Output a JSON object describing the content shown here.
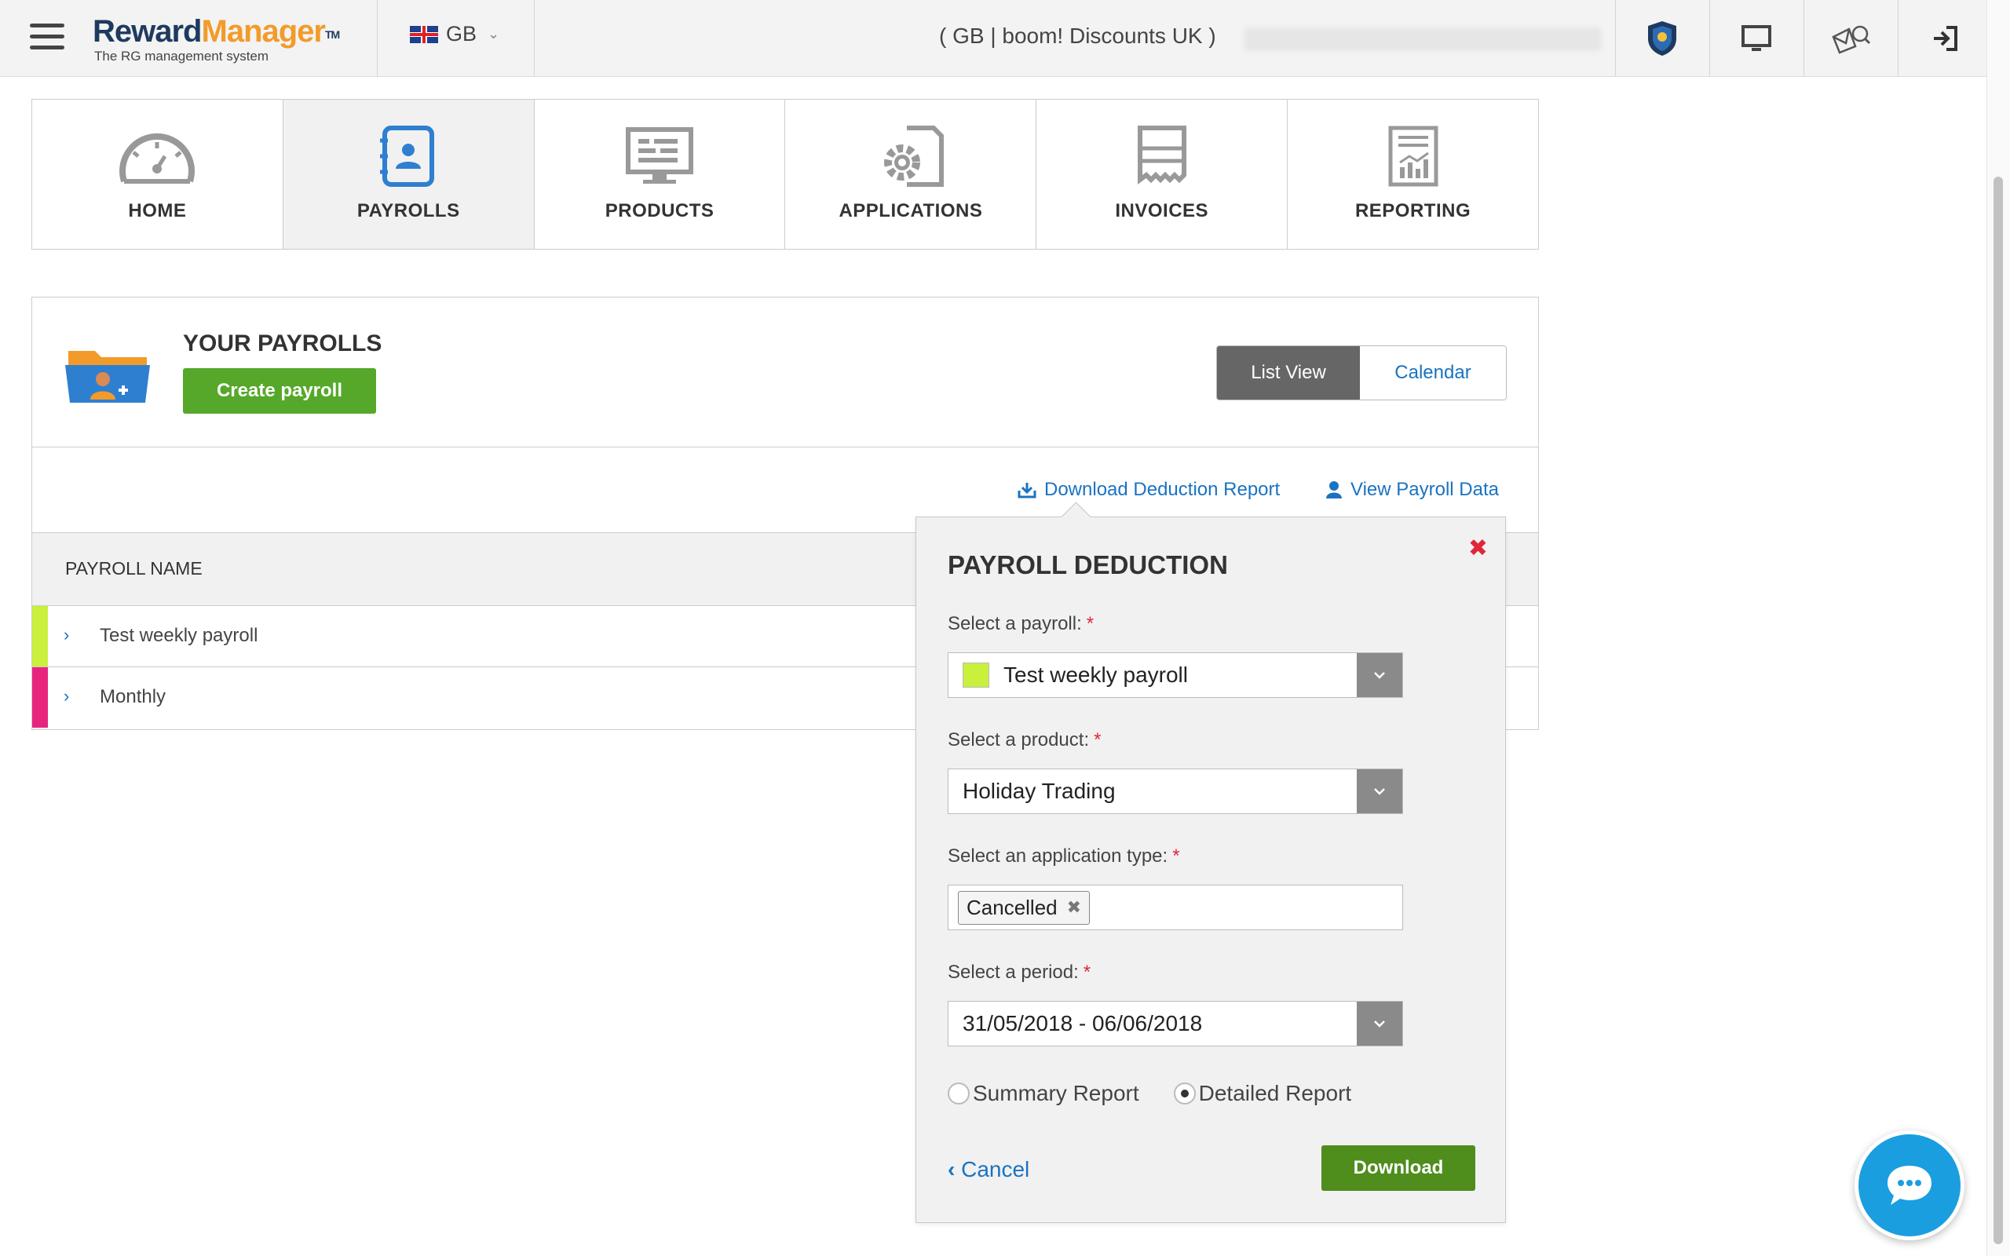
{
  "header": {
    "logo_reward": "Reward",
    "logo_manager": "Manager",
    "logo_tm": "TM",
    "logo_tagline": "The RG management system",
    "country_code": "GB",
    "company": "( GB | boom! Discounts UK )"
  },
  "nav": {
    "tiles": [
      {
        "label": "HOME",
        "icon": "dashboard-gauge-icon"
      },
      {
        "label": "PAYROLLS",
        "icon": "payroll-contact-book-icon",
        "active": true
      },
      {
        "label": "PRODUCTS",
        "icon": "monitor-products-icon"
      },
      {
        "label": "APPLICATIONS",
        "icon": "document-gear-icon"
      },
      {
        "label": "INVOICES",
        "icon": "receipt-icon"
      },
      {
        "label": "REPORTING",
        "icon": "report-chart-icon"
      }
    ]
  },
  "payrolls": {
    "title": "YOUR PAYROLLS",
    "create_label": "Create payroll",
    "view_list": "List View",
    "view_calendar": "Calendar",
    "download_link": "Download Deduction Report",
    "view_data_link": "View Payroll Data",
    "column_header": "PAYROLL NAME",
    "rows": [
      {
        "name": "Test weekly payroll",
        "color": "#c8f03c"
      },
      {
        "name": "Monthly",
        "color": "#e8257e"
      }
    ]
  },
  "popover": {
    "title": "PAYROLL DEDUCTION",
    "payroll_label": "Select a payroll:",
    "payroll_value": "Test weekly payroll",
    "product_label": "Select a product:",
    "product_value": "Holiday Trading",
    "apptype_label": "Select an application type:",
    "apptype_tag": "Cancelled",
    "period_label": "Select a period:",
    "period_value": "31/05/2018 - 06/06/2018",
    "report_summary": "Summary Report",
    "report_detailed": "Detailed Report",
    "selected_report": "Detailed Report",
    "cancel_label": "Cancel",
    "download_label": "Download",
    "required_mark": "*"
  },
  "colors": {
    "brand_navy": "#1f3a5f",
    "brand_orange": "#f29b2a",
    "primary_green": "#56a82a",
    "download_green": "#4f8d1d",
    "link_blue": "#1a73c2",
    "required_red": "#e0263a"
  }
}
